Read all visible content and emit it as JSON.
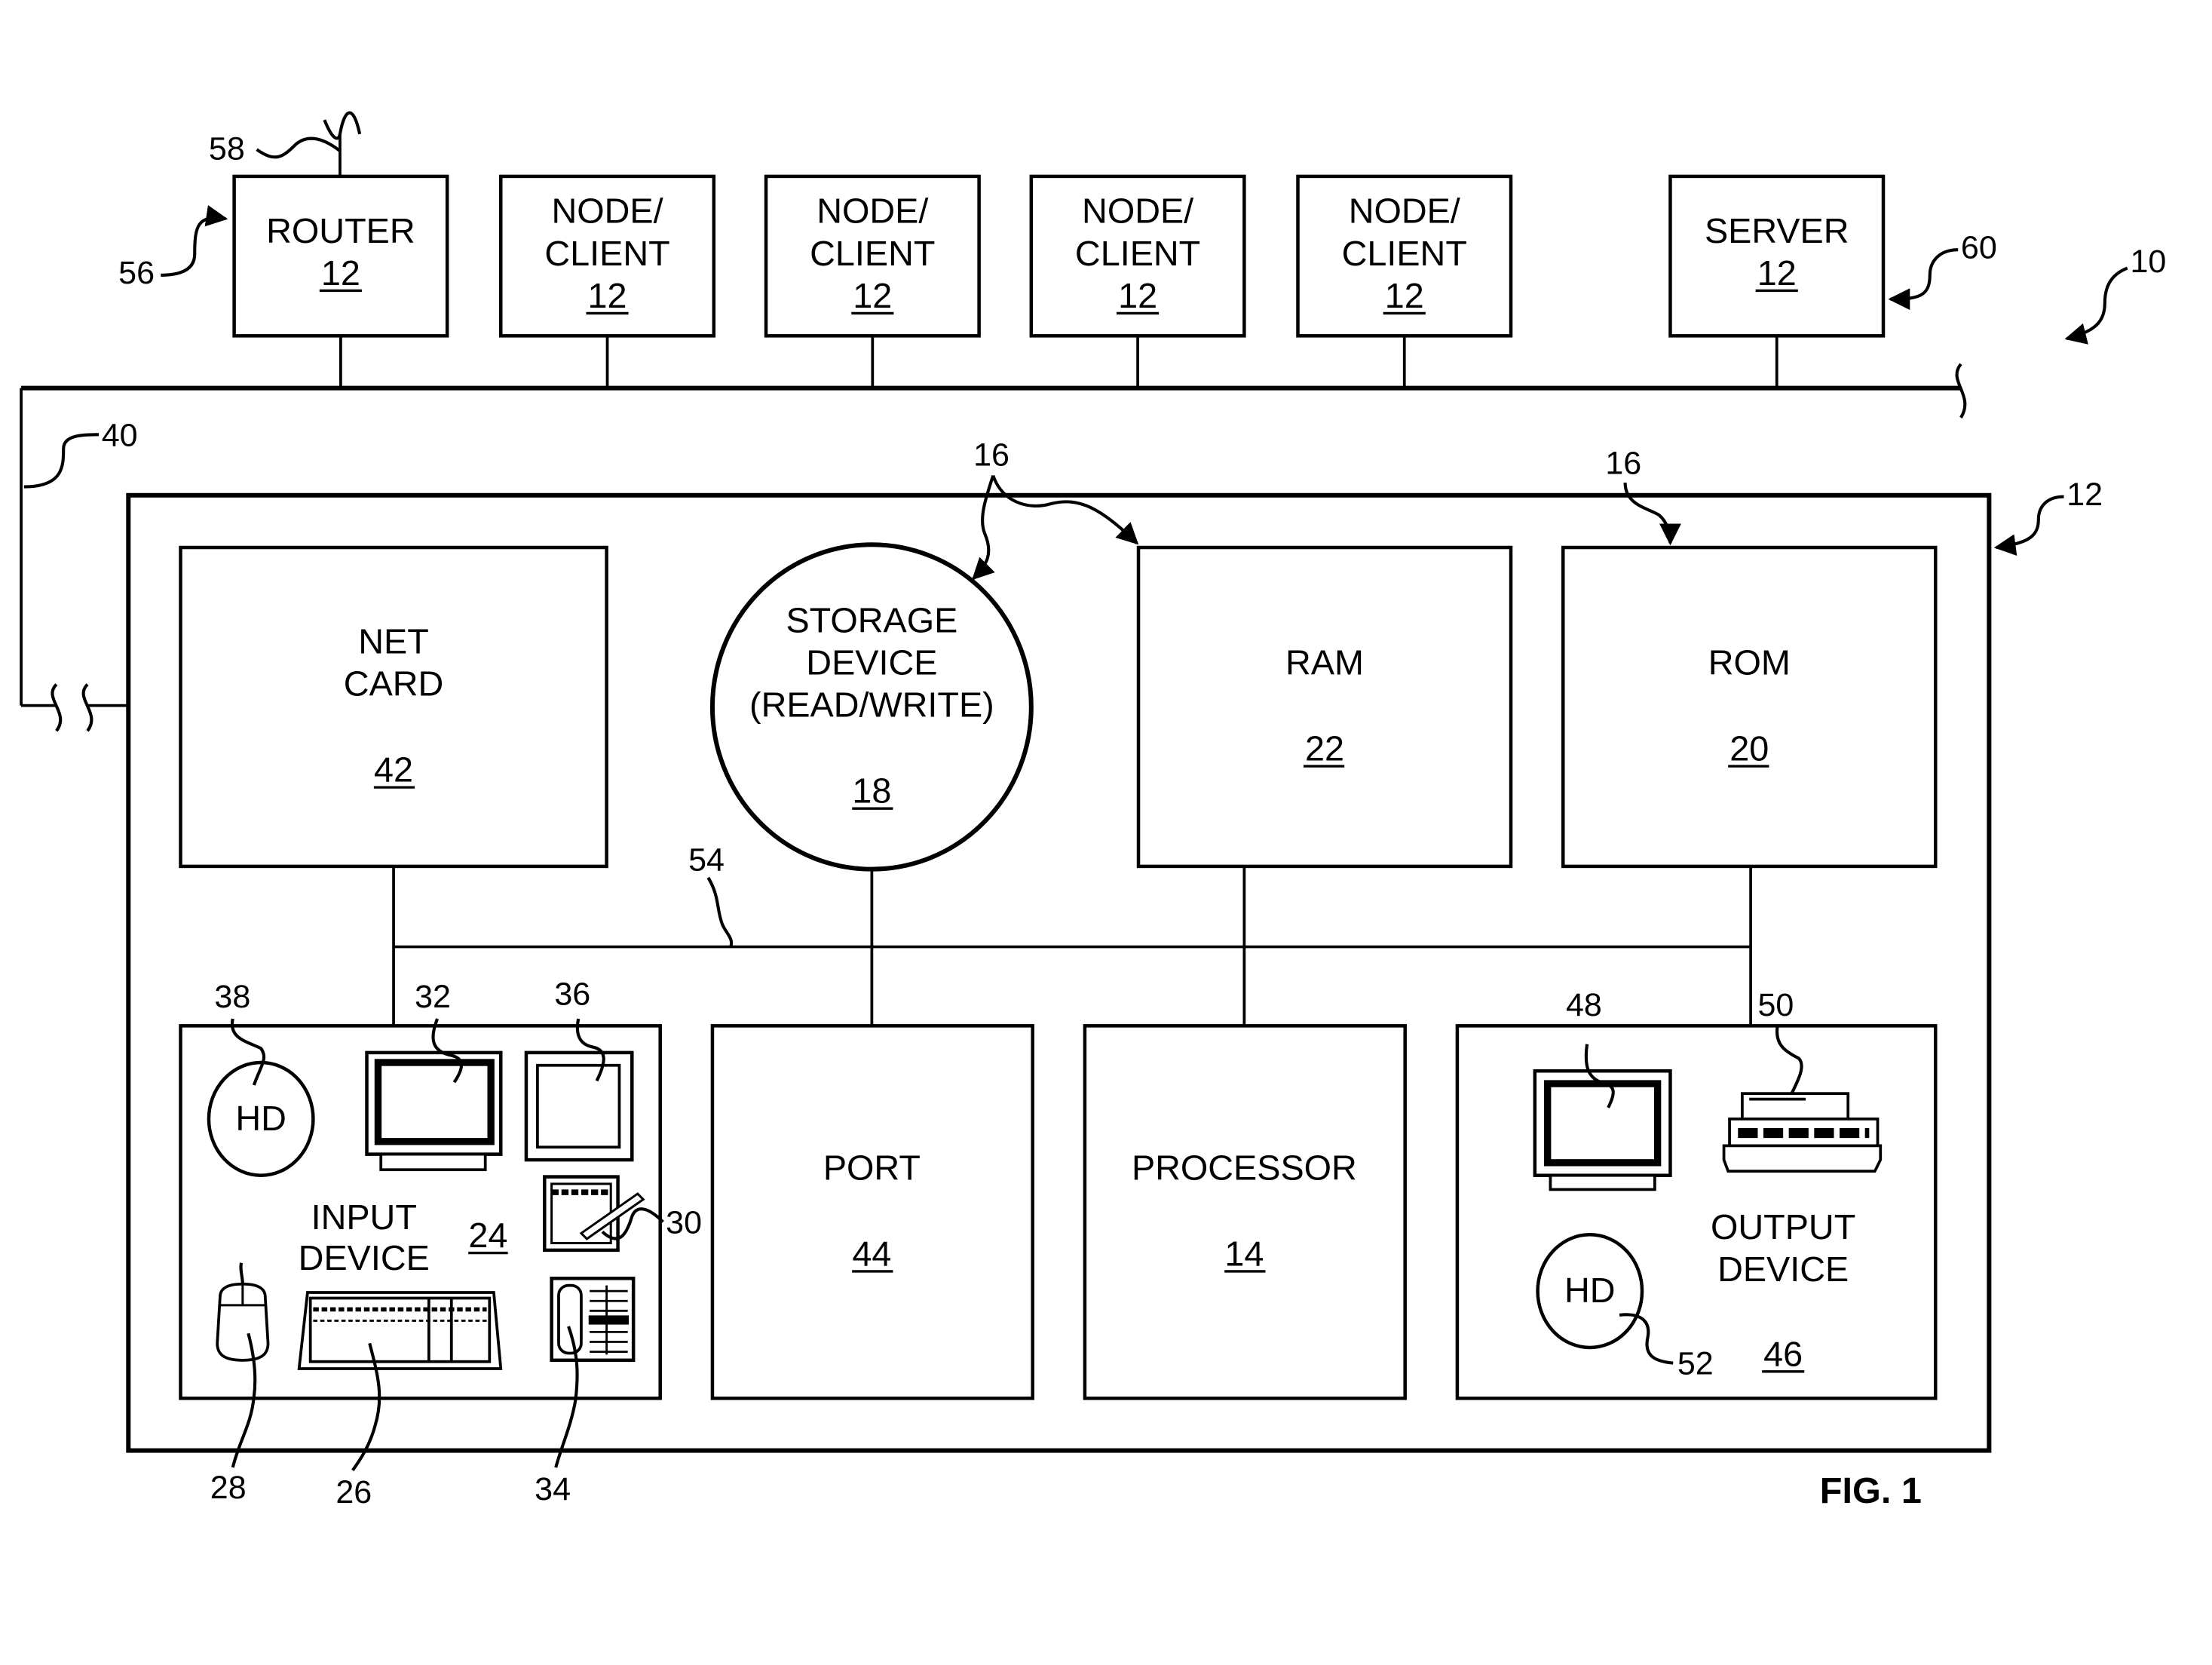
{
  "figure": {
    "title": "FIG. 1",
    "system_ref": "10",
    "network_ref": "40",
    "computer_ref": "12",
    "bus_ref": "54"
  },
  "network_nodes": [
    {
      "label_lines": [
        "ROUTER"
      ],
      "ref": "12",
      "callout": "56"
    },
    {
      "label_lines": [
        "NODE/",
        "CLIENT"
      ],
      "ref": "12"
    },
    {
      "label_lines": [
        "NODE/",
        "CLIENT"
      ],
      "ref": "12"
    },
    {
      "label_lines": [
        "NODE/",
        "CLIENT"
      ],
      "ref": "12"
    },
    {
      "label_lines": [
        "NODE/",
        "CLIENT"
      ],
      "ref": "12"
    },
    {
      "label_lines": [
        "SERVER"
      ],
      "ref": "12",
      "callout": "60"
    }
  ],
  "router_antenna_ref": "58",
  "components": {
    "net_card": {
      "label_lines": [
        "NET",
        "CARD"
      ],
      "ref": "42"
    },
    "storage": {
      "label_lines": [
        "STORAGE",
        "DEVICE",
        "(READ/WRITE)"
      ],
      "ref": "18",
      "callout": "16"
    },
    "ram": {
      "label_lines": [
        "RAM"
      ],
      "ref": "22",
      "callout": "16"
    },
    "rom": {
      "label_lines": [
        "ROM"
      ],
      "ref": "20",
      "callout": "16"
    },
    "port": {
      "label_lines": [
        "PORT"
      ],
      "ref": "44"
    },
    "processor": {
      "label_lines": [
        "PROCESSOR"
      ],
      "ref": "14"
    },
    "input_device": {
      "label_lines": [
        "INPUT",
        "DEVICE"
      ],
      "ref": "24",
      "items": {
        "hard_disk": {
          "label": "HD",
          "ref": "38"
        },
        "monitor": {
          "ref": "32"
        },
        "touch_screen": {
          "ref": "36"
        },
        "tablet": {
          "ref": "30"
        },
        "mouse": {
          "ref": "28"
        },
        "keyboard": {
          "ref": "26"
        },
        "telephone": {
          "ref": "34"
        }
      }
    },
    "output_device": {
      "label_lines": [
        "OUTPUT",
        "DEVICE"
      ],
      "ref": "46",
      "items": {
        "monitor": {
          "ref": "48"
        },
        "printer": {
          "ref": "50"
        },
        "hard_disk": {
          "label": "HD",
          "ref": "52"
        }
      }
    }
  }
}
